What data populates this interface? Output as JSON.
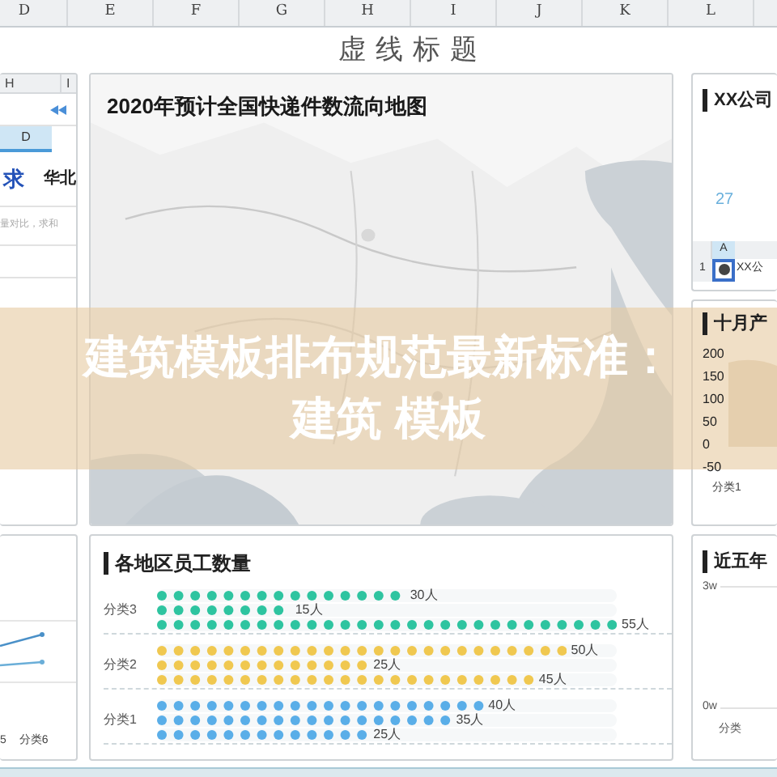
{
  "sheet": {
    "column_headers": [
      "D",
      "E",
      "F",
      "G",
      "H",
      "I",
      "J",
      "K",
      "L"
    ],
    "title": "虚线标题"
  },
  "left_fragment": {
    "column_headers": [
      "H",
      "I"
    ],
    "header_cell": "D",
    "blue_text": "求",
    "region": "华北",
    "note": "量对比，求和"
  },
  "left_line_chart": {
    "x_labels": [
      "5",
      "分类6"
    ]
  },
  "map_panel": {
    "title": "2020年预计全国快递件数流向地图"
  },
  "company_panel": {
    "title": "XX公司",
    "value": "27",
    "mini_sheet": {
      "column": "A",
      "row": "1",
      "cell": "XX公"
    }
  },
  "october_panel": {
    "title": "十月产",
    "y_labels": [
      "200",
      "150",
      "100",
      "50",
      "0",
      "-50"
    ],
    "x_label": "分类1"
  },
  "staff_panel": {
    "title": "各地区员工数量",
    "groups": [
      {
        "label": "分类3",
        "color": "#2ec4a0",
        "rows": [
          {
            "level": 0.54,
            "reading": "30人"
          },
          {
            "level": 0.29,
            "reading": "15人"
          },
          {
            "level": 1,
            "reading": "55人"
          }
        ]
      },
      {
        "label": "分类2",
        "color": "#f0c850",
        "rows": [
          {
            "level": 0.89,
            "reading": "50人"
          },
          {
            "level": 0.46,
            "reading": "25人"
          },
          {
            "level": 0.82,
            "reading": "45人"
          }
        ]
      },
      {
        "label": "分类1",
        "color": "#5aaee8",
        "rows": [
          {
            "level": 0.71,
            "reading": "40人"
          },
          {
            "level": 0.64,
            "reading": "35人"
          },
          {
            "level": 0.46,
            "reading": "25人"
          }
        ]
      }
    ]
  },
  "five_year_panel": {
    "title": "近五年",
    "y_labels": [
      "3w",
      "0w"
    ],
    "x_label": "分类"
  },
  "overlay_caption": [
    "建筑模板排布规范最新标准：",
    "建筑 模板"
  ]
}
